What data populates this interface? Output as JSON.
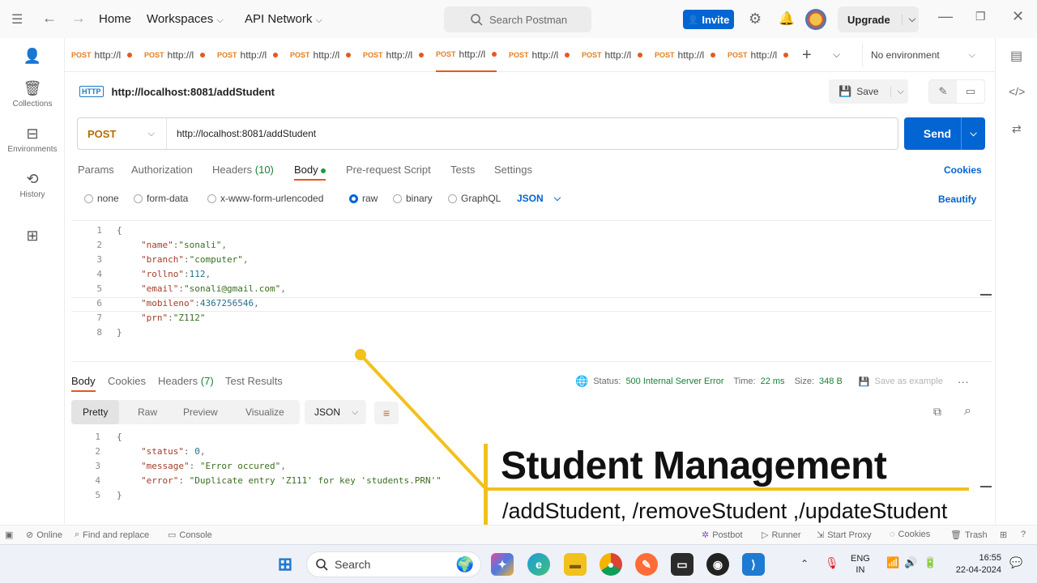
{
  "topbar": {
    "nav_home": "Home",
    "nav_workspaces": "Workspaces",
    "nav_api_network": "API Network",
    "search_placeholder": "Search Postman",
    "invite_label": "Invite",
    "upgrade_label": "Upgrade"
  },
  "sidebar": {
    "items": [
      {
        "label": "",
        "icon": "user-icon"
      },
      {
        "label": "Collections",
        "icon": "trash-can-icon"
      },
      {
        "label": "Environments",
        "icon": "environment-icon"
      },
      {
        "label": "History",
        "icon": "history-icon"
      },
      {
        "label": "",
        "icon": "apps-icon"
      }
    ]
  },
  "tabs": {
    "items": [
      {
        "method": "POST",
        "url": "http://l"
      },
      {
        "method": "POST",
        "url": "http://l"
      },
      {
        "method": "POST",
        "url": "http://l"
      },
      {
        "method": "POST",
        "url": "http://l"
      },
      {
        "method": "POST",
        "url": "http://l"
      },
      {
        "method": "POST",
        "url": "http://l"
      },
      {
        "method": "POST",
        "url": "http://l"
      },
      {
        "method": "POST",
        "url": "http://l"
      },
      {
        "method": "POST",
        "url": "http://l"
      },
      {
        "method": "POST",
        "url": "http://l"
      }
    ],
    "environment": "No environment"
  },
  "request": {
    "name": "http://localhost:8081/addStudent",
    "badge": "HTTP",
    "save_label": "Save",
    "method": "POST",
    "url": "http://localhost:8081/addStudent",
    "send_label": "Send",
    "subtabs": [
      "Params",
      "Authorization",
      "Headers",
      "(10)",
      "Body",
      "Pre-request Script",
      "Tests",
      "Settings"
    ],
    "cookies_label": "Cookies",
    "body_types": [
      "none",
      "form-data",
      "x-www-form-urlencoded",
      "raw",
      "binary",
      "GraphQL"
    ],
    "format": "JSON",
    "beautify_label": "Beautify",
    "lines": [
      "1",
      "2",
      "3",
      "4",
      "5",
      "6",
      "7",
      "8"
    ],
    "code": {
      "open": "{",
      "name_key": "\"name\"",
      "name_val": "\"sonali\"",
      "branch_key": "\"branch\"",
      "branch_val": "\"computer\"",
      "rollno_key": "\"rollno\"",
      "rollno_val": "112",
      "email_key": "\"email\"",
      "email_val": "\"sonali@gmail.com\"",
      "mobile_key": "\"mobileno\"",
      "mobile_val": "4367256546",
      "prn_key": "\"prn\"",
      "prn_val": "\"Z112\"",
      "close": "}"
    }
  },
  "response": {
    "tabs": [
      "Body",
      "Cookies",
      "Headers",
      "(7)",
      "Test Results"
    ],
    "status_label": "Status:",
    "status_value": "500 Internal Server Error",
    "time_label": "Time:",
    "time_value": "22 ms",
    "size_label": "Size:",
    "size_value": "348 B",
    "save_example": "Save as example",
    "view_modes": [
      "Pretty",
      "Raw",
      "Preview",
      "Visualize"
    ],
    "format": "JSON",
    "lines": [
      "1",
      "2",
      "3",
      "4",
      "5"
    ],
    "code": {
      "open": "{",
      "status_key": "\"status\"",
      "status_val": "0",
      "message_key": "\"message\"",
      "message_val": "\"Error occured\"",
      "error_key": "\"error\"",
      "error_val": "\"Duplicate entry 'Z111' for key 'students.PRN'\"",
      "close": "}"
    }
  },
  "overlay": {
    "title": "Student Management",
    "subtitle": "/addStudent, /removeStudent ,/updateStudent"
  },
  "statusbar": {
    "online": "Online",
    "find_replace": "Find and replace",
    "console": "Console",
    "postbot": "Postbot",
    "runner": "Runner",
    "start_proxy": "Start Proxy",
    "cookies": "Cookies",
    "trash": "Trash"
  },
  "taskbar": {
    "search_label": "Search",
    "lang_top": "ENG",
    "lang_bottom": "IN",
    "time": "16:55",
    "date": "22-04-2024"
  },
  "colors": {
    "accent_orange": "#e4591f",
    "primary_blue": "#0265d2",
    "overlay_yellow": "#f2c11c",
    "status_green": "#1a7f37"
  }
}
